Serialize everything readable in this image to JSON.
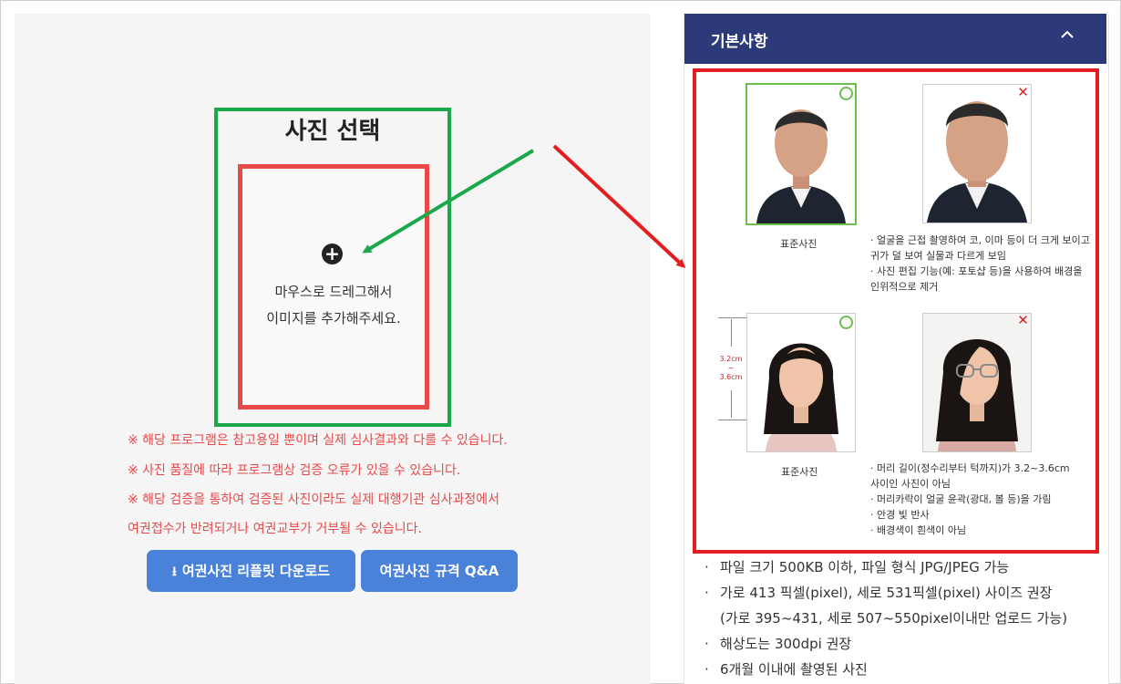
{
  "left": {
    "title": "사진 선택",
    "drop_line1": "마우스로 드레그해서",
    "drop_line2": "이미지를 추가해주세요.",
    "notices": [
      "※ 해당 프로그램은 참고용일 뿐이며 실제 심사결과와 다를 수 있습니다.",
      "※ 사진 품질에 따라 프로그램상 검증 오류가 있을 수 있습니다.",
      "※ 해당 검증을 통하여 검증된 사진이라도 실제 대행기관 심사과정에서",
      "여권접수가 반려되거나 여권교부가 거부될 수 있습니다."
    ],
    "buttons": {
      "download": "여권사진 리플릿 다운로드",
      "qa": "여권사진 규격 Q&A"
    }
  },
  "right": {
    "header_title": "기본사항",
    "caption_standard": "표준사진",
    "desc_top": [
      "· 얼굴을 근접 촬영하여 코, 이마 등이 더 크게 보이고",
      "  귀가 덜 보여 실물과 다르게 보임",
      "· 사진 편집 기능(예: 포토샵 등)을 사용하여 배경을",
      "  인위적으로 제거"
    ],
    "desc_bottom": [
      "· 머리 길이(정수리부터 턱까지)가 3.2~3.6cm",
      "  사이인 사진이 아님",
      "· 머리카락이 얼굴 윤곽(광대, 볼 등)을 가림",
      "· 안경 빛 반사",
      "· 배경색이 흰색이 아님"
    ],
    "measure_top": "3.2cm",
    "measure_mid": "~",
    "measure_bottom": "3.6cm",
    "bullets": [
      "파일 크기 500KB 이하, 파일 형식 JPG/JPEG 가능",
      "가로 413 픽셀(pixel), 세로 531픽셀(pixel) 사이즈 권장",
      "(가로 395~431, 세로 507~550pixel이내만 업로드 가능)",
      "해상도는 300dpi 권장",
      "6개월 이내에 촬영된 사진"
    ]
  },
  "colors": {
    "header_bg": "#2d3a7a",
    "button_bg": "#4a82d9",
    "notice_red": "#e84a4a",
    "highlight_green": "#1ba84a",
    "highlight_red": "#e41e1e"
  }
}
